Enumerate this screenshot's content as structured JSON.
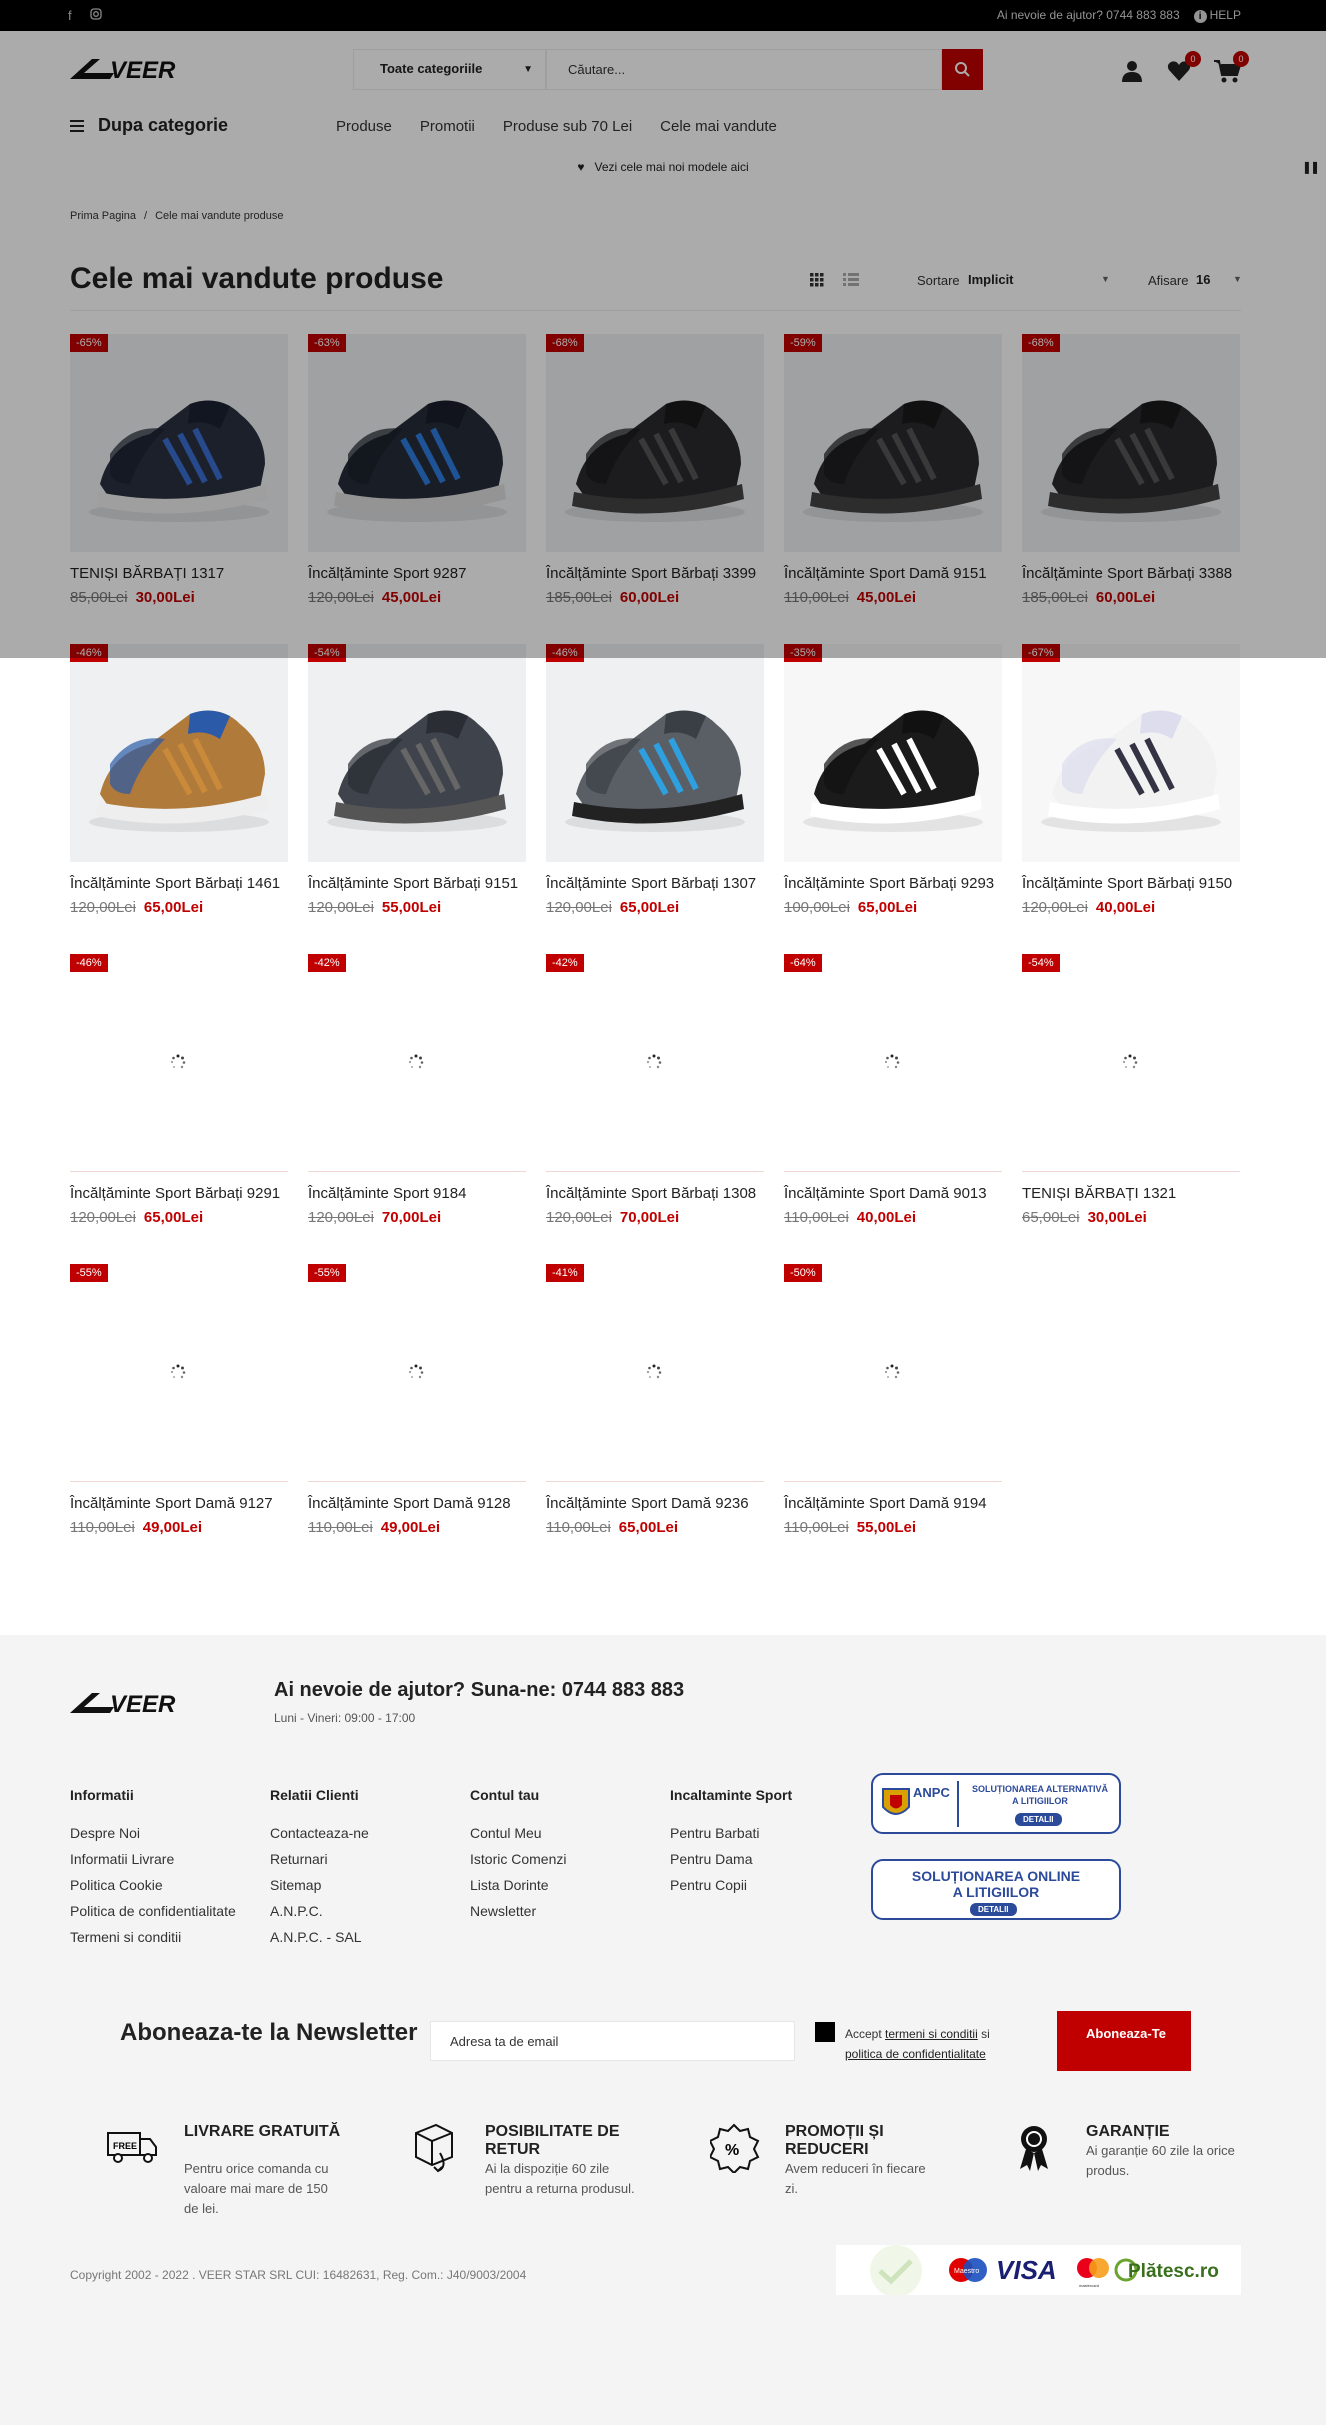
{
  "topbar": {
    "social": [
      "facebook-icon",
      "instagram-icon"
    ],
    "phone_text": "Ai nevoie de ajutor? 0744 883 883",
    "help_label": "HELP"
  },
  "header": {
    "logo_text": "VEER",
    "category_select": "Toate categoriile",
    "search_placeholder": "Căutare...",
    "wishlist_count": "0",
    "cart_count": "0"
  },
  "nav": {
    "category_label": "Dupa categorie",
    "links": [
      "Produse",
      "Promotii",
      "Produse sub 70 Lei",
      "Cele mai vandute"
    ]
  },
  "promo_bar": {
    "text": "Vezi cele mai noi modele aici"
  },
  "breadcrumb": {
    "home": "Prima Pagina",
    "sep": "/",
    "current": "Cele mai vandute produse"
  },
  "page_title": "Cele mai vandute produse",
  "toolbar": {
    "sort_label": "Sortare",
    "sort_value": "Implicit",
    "show_label": "Afisare",
    "show_value": "16"
  },
  "products": [
    {
      "discount": "-65%",
      "name": "TENIȘI BĂRBAȚI 1317",
      "old_price": "85,00Lei",
      "price": "30,00Lei",
      "image": "dark-sneaker"
    },
    {
      "discount": "-63%",
      "name": "Încălțăminte Sport 9287",
      "old_price": "120,00Lei",
      "price": "45,00Lei",
      "image": "dark-blue-sneaker"
    },
    {
      "discount": "-68%",
      "name": "Încălțăminte Sport Bărbați 3399",
      "old_price": "185,00Lei",
      "price": "60,00Lei",
      "image": "black-sneaker"
    },
    {
      "discount": "-59%",
      "name": "Încălțăminte Sport Damă 9151",
      "old_price": "110,00Lei",
      "price": "45,00Lei",
      "image": "black-sneaker"
    },
    {
      "discount": "-68%",
      "name": "Încălțăminte Sport Bărbați 3388",
      "old_price": "185,00Lei",
      "price": "60,00Lei",
      "image": "black-sneaker"
    },
    {
      "discount": "-46%",
      "name": "Încălțăminte Sport Bărbați 1461",
      "old_price": "120,00Lei",
      "price": "65,00Lei",
      "image": "tan-blue-sneaker"
    },
    {
      "discount": "-54%",
      "name": "Încălțăminte Sport Bărbați 9151",
      "old_price": "120,00Lei",
      "price": "55,00Lei",
      "image": "grey-sneaker"
    },
    {
      "discount": "-46%",
      "name": "Încălțăminte Sport Bărbați 1307",
      "old_price": "120,00Lei",
      "price": "65,00Lei",
      "image": "grey-blue-sneaker"
    },
    {
      "discount": "-35%",
      "name": "Încălțăminte Sport Bărbați 9293",
      "old_price": "100,00Lei",
      "price": "65,00Lei",
      "image": "black-white-sneaker"
    },
    {
      "discount": "-67%",
      "name": "Încălțăminte Sport Bărbați 9150",
      "old_price": "120,00Lei",
      "price": "40,00Lei",
      "image": "white-sneaker"
    },
    {
      "discount": "-46%",
      "name": "Încălțăminte Sport Bărbați 9291",
      "old_price": "120,00Lei",
      "price": "65,00Lei",
      "image": "loading"
    },
    {
      "discount": "-42%",
      "name": "Încălțăminte Sport 9184",
      "old_price": "120,00Lei",
      "price": "70,00Lei",
      "image": "loading"
    },
    {
      "discount": "-42%",
      "name": "Încălțăminte Sport Bărbați 1308",
      "old_price": "120,00Lei",
      "price": "70,00Lei",
      "image": "loading"
    },
    {
      "discount": "-64%",
      "name": "Încălțăminte Sport Damă 9013",
      "old_price": "110,00Lei",
      "price": "40,00Lei",
      "image": "loading"
    },
    {
      "discount": "-54%",
      "name": "TENIȘI BĂRBAȚI 1321",
      "old_price": "65,00Lei",
      "price": "30,00Lei",
      "image": "loading"
    },
    {
      "discount": "-55%",
      "name": "Încălțăminte Sport Damă 9127",
      "old_price": "110,00Lei",
      "price": "49,00Lei",
      "image": "loading"
    },
    {
      "discount": "-55%",
      "name": "Încălțăminte Sport Damă 9128",
      "old_price": "110,00Lei",
      "price": "49,00Lei",
      "image": "loading"
    },
    {
      "discount": "-41%",
      "name": "Încălțăminte Sport Damă 9236",
      "old_price": "110,00Lei",
      "price": "65,00Lei",
      "image": "loading"
    },
    {
      "discount": "-50%",
      "name": "Încălțăminte Sport Damă 9194",
      "old_price": "110,00Lei",
      "price": "55,00Lei",
      "image": "loading"
    }
  ],
  "footer": {
    "help_title": "Ai nevoie de ajutor? Suna-ne: 0744 883 883",
    "hours": "Luni - Vineri: 09:00 - 17:00",
    "columns": [
      {
        "title": "Informatii",
        "links": [
          "Despre Noi",
          "Informatii Livrare",
          "Politica Cookie",
          "Politica de confidentialitate",
          "Termeni si conditii"
        ]
      },
      {
        "title": "Relatii Clienti",
        "links": [
          "Contacteaza-ne",
          "Returnari",
          "Sitemap",
          "A.N.P.C.",
          "A.N.P.C. - SAL"
        ]
      },
      {
        "title": "Contul tau",
        "links": [
          "Contul Meu",
          "Istoric Comenzi",
          "Lista Dorinte",
          "Newsletter"
        ]
      },
      {
        "title": "Incaltaminte Sport",
        "links": [
          "Pentru Barbati",
          "Pentru Dama",
          "Pentru Copii"
        ]
      }
    ],
    "anpc1": {
      "brand": "ANPC",
      "line1": "SOLUȚIONAREA ALTERNATIVĂ",
      "line2": "A LITIGIILOR",
      "button": "DETALII"
    },
    "anpc2": {
      "line1": "SOLUȚIONAREA ONLINE",
      "line2": "A LITIGIILOR",
      "button": "DETALII"
    },
    "newsletter": {
      "title": "Aboneaza-te la Newsletter",
      "placeholder": "Adresa ta de email",
      "accept_prefix": "Accept",
      "terms": "termeni si conditii",
      "and": "si",
      "privacy": "politica de confidentialitate",
      "button": "Aboneaza-Te"
    },
    "features": [
      {
        "icon": "free-delivery-icon",
        "title": "LIVRARE GRATUITĂ",
        "text": "Pentru orice comanda cu valoare mai mare de 150 de lei."
      },
      {
        "icon": "return-box-icon",
        "title": "POSIBILITATE DE RETUR",
        "text": "Ai la dispoziție 60 zile pentru a returna produsul."
      },
      {
        "icon": "discount-icon",
        "title": "PROMOȚII ȘI REDUCERI",
        "text": "Avem reduceri în fiecare zi."
      },
      {
        "icon": "warranty-icon",
        "title": "GARANȚIE",
        "text": "Ai garanție 60 zile la orice produs."
      }
    ],
    "copyright": "Copyright 2002 - 2022 . VEER STAR SRL CUI: 16482631, Reg. Com.: J40/9003/2004",
    "payment": {
      "logos": [
        "Maestro",
        "VISA",
        "mastercard",
        "Plătesc.ro"
      ]
    }
  },
  "colors": {
    "accent": "#c00000",
    "footer_bg": "#f4f4f4",
    "anpc_blue": "#2c4a9a"
  }
}
